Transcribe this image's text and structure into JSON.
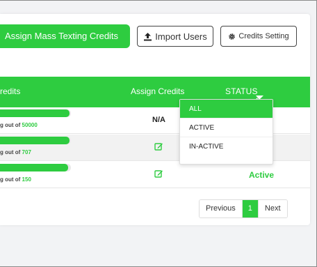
{
  "toolbar": {
    "assign_mass_label": "Assign Mass Texting Credits",
    "import_label": "Import Users",
    "credits_setting_label": "Credits Setting"
  },
  "table": {
    "headers": {
      "credits": "redits",
      "assign": "Assign Credits",
      "status": "STATUS"
    },
    "rows": [
      {
        "prefix": "g out of ",
        "total": "50000",
        "fill": 0.98,
        "assign": "N/A",
        "status": ""
      },
      {
        "prefix": "g out of ",
        "total": "707",
        "fill": 0.98,
        "assign": "",
        "status": ""
      },
      {
        "prefix": "g out of ",
        "total": "150",
        "fill": 0.96,
        "assign": "",
        "status": "Active"
      }
    ]
  },
  "status_filter": {
    "options": [
      "ALL",
      "ACTIVE",
      "IN-ACTIVE"
    ],
    "selected": "ALL"
  },
  "pagination": {
    "previous": "Previous",
    "current": "1",
    "next": "Next"
  },
  "colors": {
    "accent": "#2ecc40"
  }
}
